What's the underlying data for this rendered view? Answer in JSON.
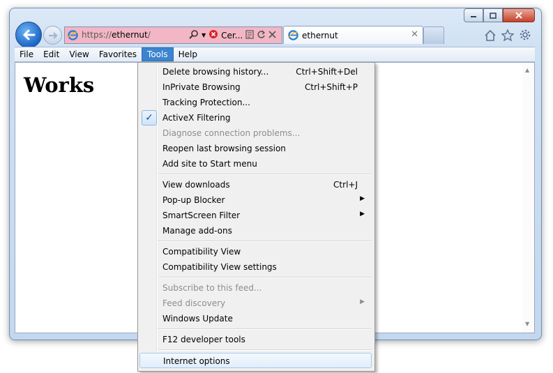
{
  "window": {
    "minimize_icon": "minimize-icon",
    "maximize_icon": "maximize-icon",
    "close_icon": "close-icon"
  },
  "nav": {
    "address_prefix": "https://",
    "address_host": "ethernut",
    "address_suffix": "/",
    "cert_label": "Cer...",
    "tab_title": "ethernut",
    "tab_close": "✕",
    "address_bar_color": "#f2b6c4"
  },
  "menubar": {
    "items": [
      "File",
      "Edit",
      "View",
      "Favorites",
      "Tools",
      "Help"
    ],
    "active": "Tools"
  },
  "page": {
    "heading": "Works"
  },
  "tools_menu": {
    "items": [
      {
        "label": "Delete browsing history...",
        "shortcut": "Ctrl+Shift+Del"
      },
      {
        "label": "InPrivate Browsing",
        "shortcut": "Ctrl+Shift+P"
      },
      {
        "label": "Tracking Protection..."
      },
      {
        "label": "ActiveX Filtering",
        "checked": true
      },
      {
        "label": "Diagnose connection problems...",
        "disabled": true
      },
      {
        "label": "Reopen last browsing session"
      },
      {
        "label": "Add site to Start menu"
      },
      {
        "label": "View downloads",
        "shortcut": "Ctrl+J"
      },
      {
        "label": "Pop-up Blocker",
        "submenu": true
      },
      {
        "label": "SmartScreen Filter",
        "submenu": true
      },
      {
        "label": "Manage add-ons"
      },
      {
        "label": "Compatibility View"
      },
      {
        "label": "Compatibility View settings"
      },
      {
        "label": "Subscribe to this feed...",
        "disabled": true
      },
      {
        "label": "Feed discovery",
        "disabled": true,
        "submenu": true
      },
      {
        "label": "Windows Update"
      },
      {
        "label": "F12 developer tools"
      },
      {
        "label": "Internet options",
        "highlighted": true
      }
    ],
    "check_glyph": "✓",
    "submenu_glyph": "▶"
  }
}
